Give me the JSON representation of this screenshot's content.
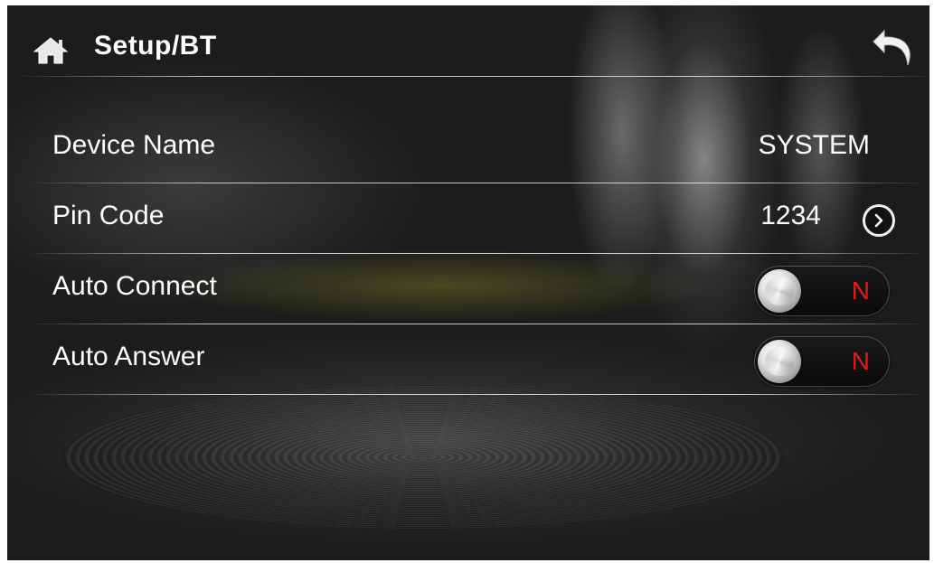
{
  "header": {
    "title": "Setup/BT",
    "home_icon": "home-icon",
    "back_icon": "back-arrow-icon"
  },
  "settings": {
    "device_name": {
      "label": "Device Name",
      "value": "SYSTEM"
    },
    "pin_code": {
      "label": "Pin Code",
      "value": "1234",
      "action_icon": "chevron-right-circle-icon"
    },
    "auto_connect": {
      "label": "Auto Connect",
      "state": "N"
    },
    "auto_answer": {
      "label": "Auto Answer",
      "state": "N"
    }
  },
  "colors": {
    "toggle_off_text": "#e21b1b",
    "text": "#ffffff"
  }
}
